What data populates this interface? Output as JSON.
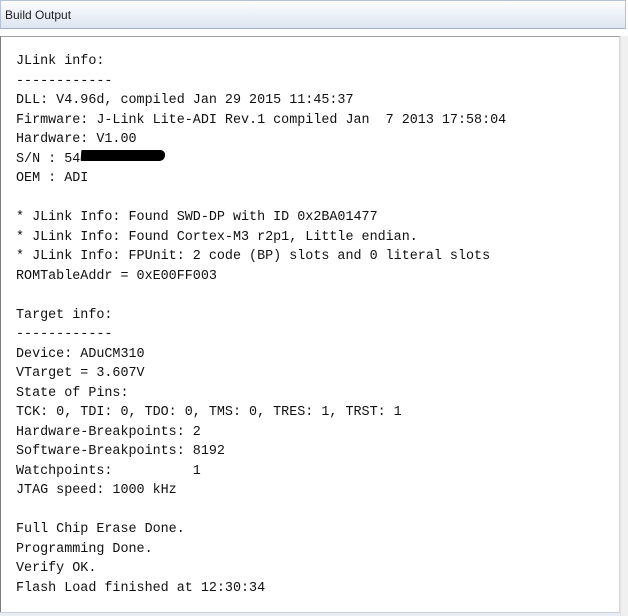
{
  "window": {
    "title": "Build Output"
  },
  "output": {
    "lines": [
      "JLink info:",
      "------------",
      "DLL: V4.96d, compiled Jan 29 2015 11:45:37",
      "Firmware: J-Link Lite-ADI Rev.1 compiled Jan  7 2013 17:58:04",
      "Hardware: V1.00",
      "S/N : 54",
      "OEM : ADI",
      "",
      "* JLink Info: Found SWD-DP with ID 0x2BA01477",
      "* JLink Info: Found Cortex-M3 r2p1, Little endian.",
      "* JLink Info: FPUnit: 2 code (BP) slots and 0 literal slots",
      "ROMTableAddr = 0xE00FF003",
      "",
      "Target info:",
      "------------",
      "Device: ADuCM310",
      "VTarget = 3.607V",
      "State of Pins:",
      "TCK: 0, TDI: 0, TDO: 0, TMS: 0, TRES: 1, TRST: 1",
      "Hardware-Breakpoints: 2",
      "Software-Breakpoints: 8192",
      "Watchpoints:          1",
      "JTAG speed: 1000 kHz",
      "",
      "Full Chip Erase Done.",
      "Programming Done.",
      "Verify OK.",
      "Flash Load finished at 12:30:34"
    ]
  }
}
